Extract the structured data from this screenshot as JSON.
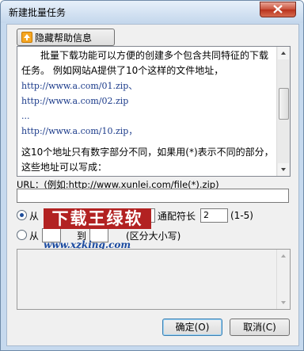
{
  "window": {
    "title": "新建批量任务"
  },
  "help_button": {
    "label": "隐藏帮助信息"
  },
  "help_text": {
    "para1": "批量下载功能可以方便的创建多个包含共同特征的下载任务。 例如网站A提供了10个这样的文件地址，",
    "urls": [
      "http://www.a.com/01.zip、",
      "http://www.a.com/02.zip",
      "...",
      "http://www.a.com/10.zip，"
    ],
    "para2": "这10个地址只有数字部分不同，如果用(*)表示不同的部分，这些地址可以写成："
  },
  "url_field": {
    "label": "URL：(例如:http://www.xunlei.com/file(*).zip)",
    "value": ""
  },
  "options": {
    "row1_from": "从",
    "row1_width_label": "通配符长",
    "row1_width_value": "2",
    "row1_range": "(1-5)",
    "row2_from": "从",
    "row2_to": "到",
    "row2_note": "(区分大小写)"
  },
  "watermark": {
    "text": "下载王绿软",
    "url": "www.xzking.com"
  },
  "buttons": {
    "ok": "确定(O)",
    "cancel": "取消(C)"
  }
}
